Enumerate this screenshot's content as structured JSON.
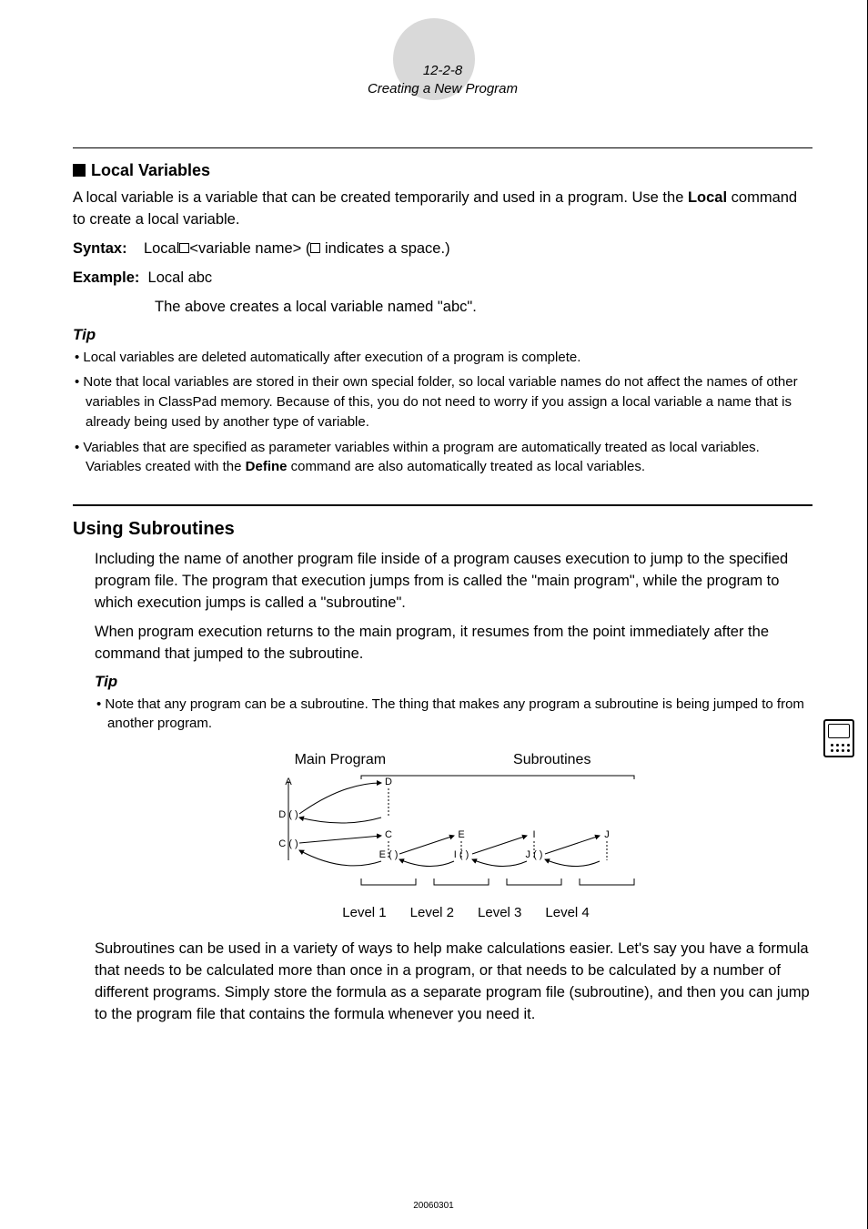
{
  "header": {
    "section_number": "12-2-8",
    "section_title": "Creating a New Program"
  },
  "local_vars": {
    "heading": "Local Variables",
    "intro_pre": "A local variable is a variable that can be created temporarily and used in a program. Use the ",
    "intro_bold": "Local",
    "intro_post": " command to create a local variable.",
    "syntax_label": "Syntax:",
    "syntax_body_pre": "Local",
    "syntax_body_mid": "<variable name>  (",
    "syntax_body_post": " indicates a space.)",
    "example_label": "Example:",
    "example_body": "Local abc",
    "example_note": "The above creates a local variable named \"abc\".",
    "tip_label": "Tip",
    "tips": [
      "Local variables are deleted automatically after execution of a program is complete.",
      "Note that local variables are stored in their own special folder, so local variable names do not affect the names of other variables in ClassPad memory. Because of this, you do not need to worry if you assign a local variable a name that is already being used by another type of variable."
    ],
    "tip3_pre": "Variables that are specified as parameter variables within a program are automatically treated as local variables. Variables created with the ",
    "tip3_bold": "Define",
    "tip3_post": " command are also automatically treated as local variables."
  },
  "subroutines": {
    "heading": "Using Subroutines",
    "p1": "Including the name of another program file inside of a program causes execution to jump to the specified program file. The program that execution jumps from is called the \"main program\", while the program to which execution jumps is called a \"subroutine\".",
    "p2": "When program execution returns to the main program, it resumes from the point immediately after the command that jumped to the subroutine.",
    "tip_label": "Tip",
    "tip": "Note that any program can be a subroutine. The thing that makes any program a subroutine is being jumped to from another program.",
    "diagram": {
      "main_label": "Main Program",
      "sub_label": "Subroutines",
      "nodes": {
        "A": "A",
        "D": "D",
        "C": "C",
        "E": "E",
        "I": "I",
        "J": "J"
      },
      "calls": {
        "D": "D ( )",
        "C": "C ( )",
        "E": "E ( )",
        "Icall": "I ( )",
        "Jcall": "J ( )"
      },
      "levels": [
        "Level 1",
        "Level 2",
        "Level 3",
        "Level 4"
      ]
    },
    "p3": "Subroutines can be used in a variety of ways to help make calculations easier. Let's say you have a formula that needs to be calculated more than once in a program, or that needs to be calculated by a number of different programs. Simply store the formula as a separate program file (subroutine), and then you can jump to the program file that contains the formula whenever you need it."
  },
  "footer_code": "20060301"
}
